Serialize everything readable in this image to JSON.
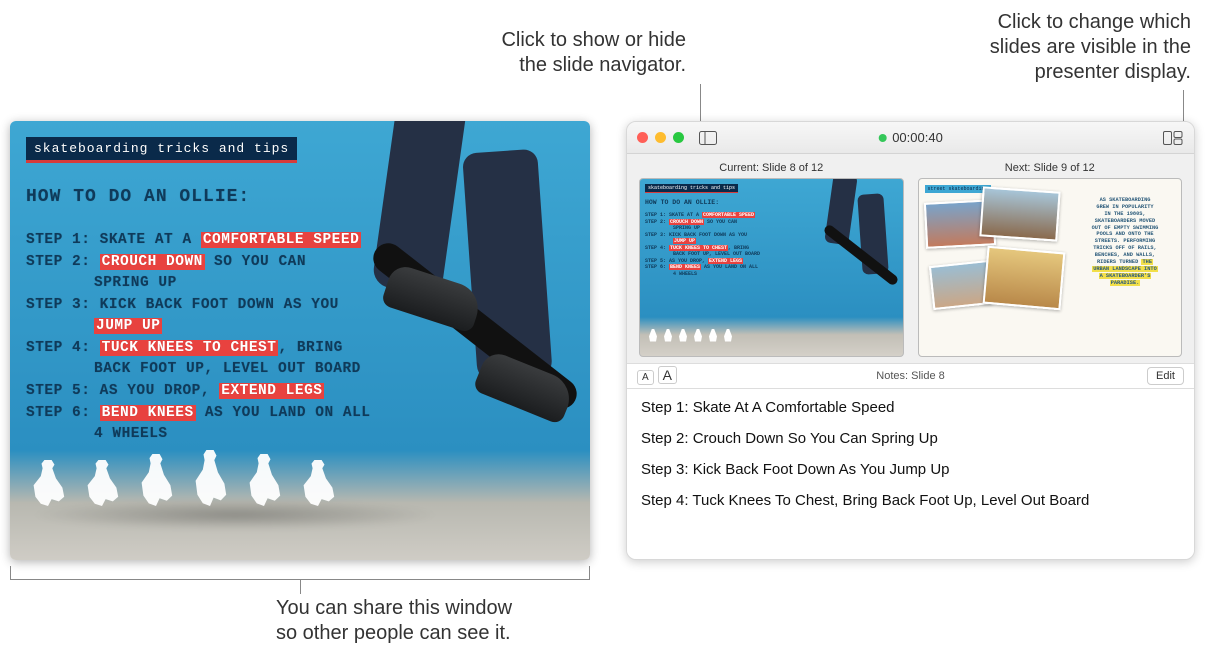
{
  "callouts": {
    "navigator": "Click to show or hide\nthe slide navigator.",
    "layout": "Click to change which\nslides are visible in the\npresenter display.",
    "share": "You can share this window\nso other people can see it."
  },
  "slide": {
    "tag": "skateboarding tricks and tips",
    "title": "HOW TO DO AN OLLIE:",
    "steps": [
      {
        "label": "STEP 1:",
        "pre": "SKATE AT A ",
        "hl": "COMFORTABLE SPEED",
        "post": ""
      },
      {
        "label": "STEP 2:",
        "pre": "",
        "hl": "CROUCH DOWN",
        "post": " SO YOU CAN",
        "cont": "SPRING UP"
      },
      {
        "label": "STEP 3:",
        "pre": "KICK BACK FOOT DOWN AS YOU",
        "hl": "",
        "post": "",
        "cont_hl": "JUMP UP"
      },
      {
        "label": "STEP 4:",
        "pre": "",
        "hl": "TUCK KNEES TO CHEST",
        "post": ", BRING",
        "cont": "BACK FOOT UP, LEVEL OUT BOARD"
      },
      {
        "label": "STEP 5:",
        "pre": "AS YOU DROP, ",
        "hl": "EXTEND LEGS",
        "post": ""
      },
      {
        "label": "STEP 6:",
        "pre": "",
        "hl": "BEND KNEES",
        "post": " AS YOU LAND ON ALL",
        "cont": "4 WHEELS"
      }
    ]
  },
  "presenter": {
    "timer": "00:00:40",
    "current_label": "Current: Slide 8 of 12",
    "next_label": "Next: Slide 9 of 12",
    "notes_label": "Notes: Slide 8",
    "edit_label": "Edit",
    "font_small": "A",
    "font_big": "A",
    "notes": [
      "Step 1: Skate At A Comfortable Speed",
      "Step 2: Crouch Down So You Can Spring Up",
      "Step 3: Kick Back Foot Down As You Jump Up",
      "Step 4: Tuck Knees To Chest, Bring Back Foot Up, Level Out Board"
    ],
    "next_slide": {
      "tag": "street skateboarding",
      "body_lines": [
        "AS SKATEBOARDING",
        "GREW IN POPULARITY",
        "IN THE 1980S,",
        "SKATEBOARDERS MOVED",
        "OUT OF EMPTY SWIMMING",
        "POOLS AND ONTO THE",
        "STREETS. PERFORMING",
        "TRICKS OFF OF RAILS,",
        "BENCHES, AND WALLS,",
        "RIDERS TURNED"
      ],
      "body_hl1": "THE",
      "body_hl2": "URBAN LANDSCAPE INTO",
      "body_hl3": "A SKATEBOARDER'S",
      "body_hl4": "PARADISE."
    }
  }
}
